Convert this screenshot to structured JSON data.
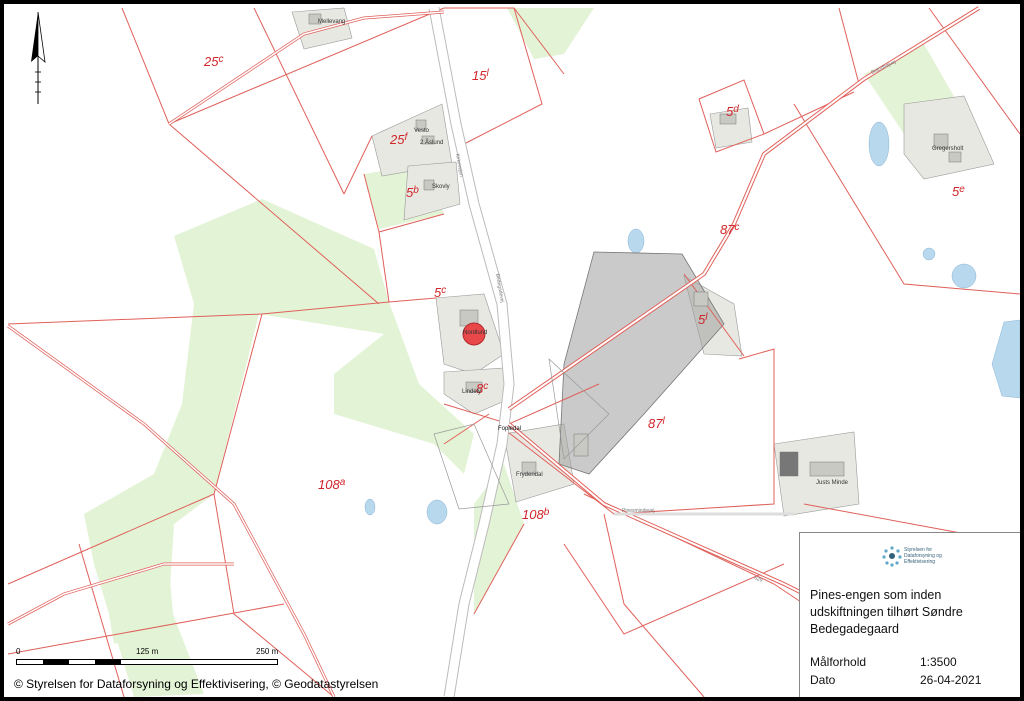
{
  "map": {
    "parcels": [
      {
        "num": "25",
        "sup": "c"
      },
      {
        "num": "15",
        "sup": "l"
      },
      {
        "num": "25",
        "sup": "f"
      },
      {
        "num": "5",
        "sup": "b"
      },
      {
        "num": "5",
        "sup": "d"
      },
      {
        "num": "5",
        "sup": "e"
      },
      {
        "num": "87",
        "sup": "c"
      },
      {
        "num": "5",
        "sup": "c"
      },
      {
        "num": "5",
        "sup": "l"
      },
      {
        "num": "8",
        "sup": "c"
      },
      {
        "num": "87",
        "sup": "l"
      },
      {
        "num": "108",
        "sup": "a"
      },
      {
        "num": "108",
        "sup": "b"
      }
    ],
    "places": {
      "mellevang": "Mellevang",
      "vesto": "Vesto",
      "aaslund": "2 Åslund",
      "skovly": "Skovly",
      "gregersholt": "Gregersholt",
      "nordlund": "Nordlund",
      "lindely": "Lindely",
      "fopledal": "Fopledal",
      "fryderidal": "Fryderidal",
      "justs_minde": "Justs Minde"
    },
    "roads": {
      "r1": "Kirkevejen",
      "r2": "Bedegadevej",
      "r3": "Pinesmindevej",
      "r4": "629",
      "r5": "Brandhøjvej"
    }
  },
  "scale": {
    "ticks": [
      "0",
      "125 m",
      "250 m"
    ]
  },
  "copyright": "© Styrelsen for Dataforsyning og Effektivisering, © Geodatastyrelsen",
  "legend": {
    "logo_text": [
      "Styrelsen for",
      "Dataforsyning og",
      "Effektivisering"
    ],
    "title": "Pines-engen som inden udskiftningen tilhørt Søndre Bedegadegaard",
    "scale_label": "Målforhold",
    "scale_value": "1:3500",
    "date_label": "Dato",
    "date_value": "26-04-2021"
  },
  "colors": {
    "parcel_line": "#e0605a",
    "green": "#e3f3d6",
    "building_area": "#e8e8e2",
    "water": "#b8d8ee",
    "highlight": "#9e9e9e",
    "marker": "#e8484a"
  }
}
